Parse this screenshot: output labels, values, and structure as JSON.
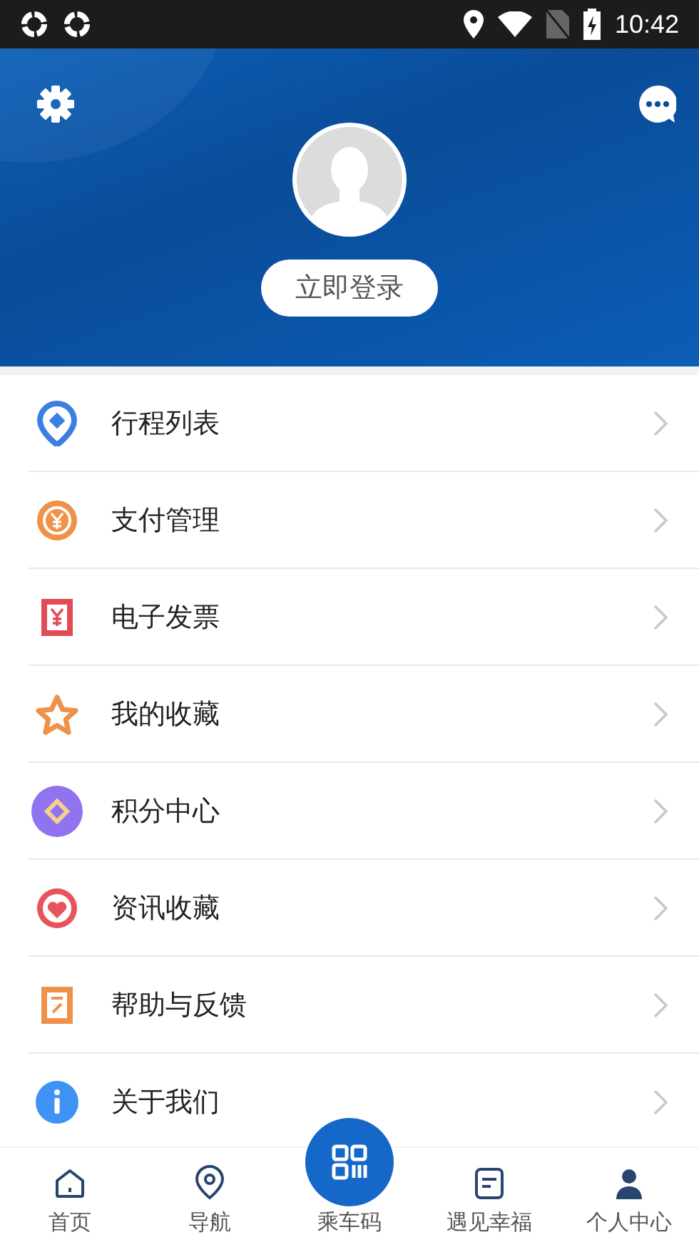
{
  "status_bar": {
    "time": "10:42"
  },
  "header": {
    "login_button": "立即登录"
  },
  "menu": [
    {
      "kind": "trip",
      "label": "行程列表"
    },
    {
      "kind": "payment",
      "label": "支付管理"
    },
    {
      "kind": "invoice",
      "label": "电子发票"
    },
    {
      "kind": "favorite",
      "label": "我的收藏"
    },
    {
      "kind": "points",
      "label": "积分中心"
    },
    {
      "kind": "news",
      "label": "资讯收藏"
    },
    {
      "kind": "help",
      "label": "帮助与反馈"
    },
    {
      "kind": "about",
      "label": "关于我们"
    }
  ],
  "bottom_nav": [
    {
      "kind": "home",
      "label": "首页"
    },
    {
      "kind": "nav",
      "label": "导航"
    },
    {
      "kind": "qr",
      "label": "乘车码"
    },
    {
      "kind": "note",
      "label": "遇见幸福"
    },
    {
      "kind": "user",
      "label": "个人中心"
    }
  ]
}
